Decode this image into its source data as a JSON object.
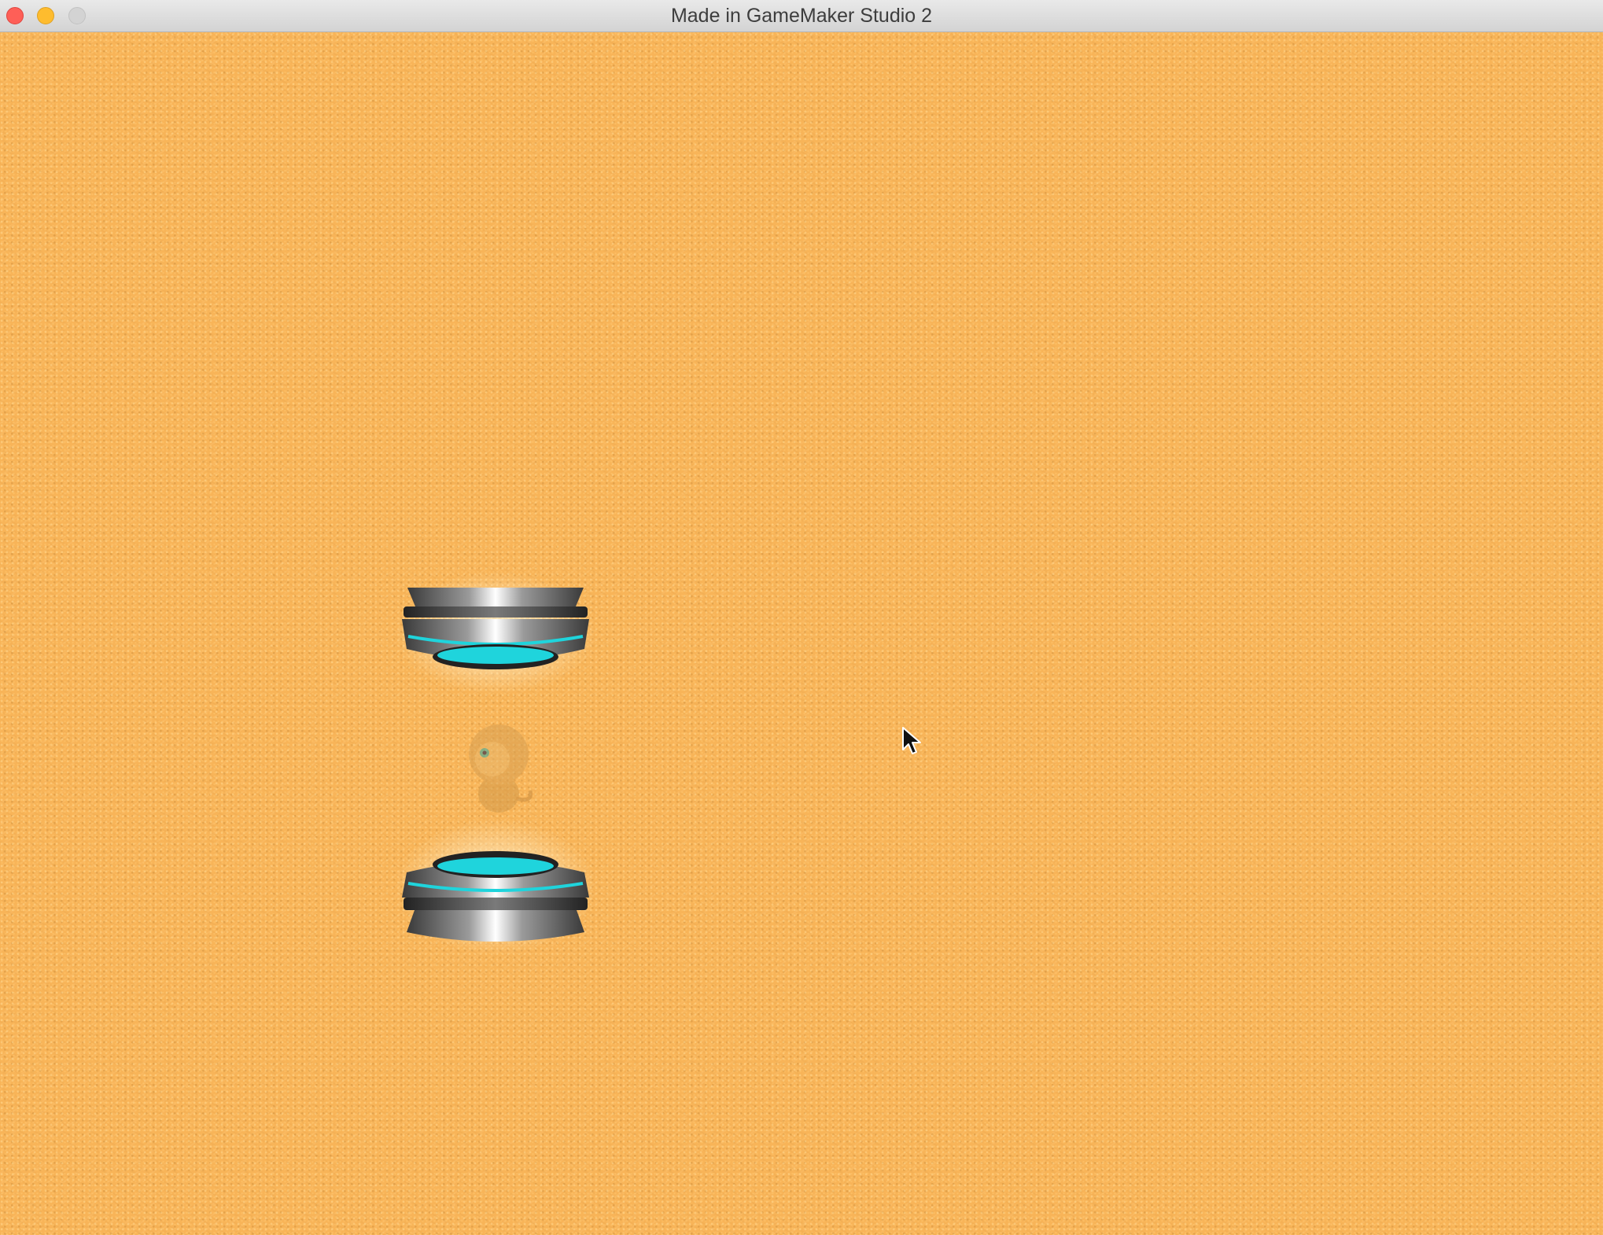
{
  "window": {
    "title": "Made in GameMaker Studio 2",
    "controls": [
      "close",
      "minimize",
      "zoom"
    ]
  },
  "scene": {
    "background": "sand",
    "background_color": "#f8b458",
    "portal_glow_color": "#1fd4dc",
    "sprites": [
      {
        "name": "teleporter-top",
        "icon": "teleporter-icon",
        "orientation": "upside-down"
      },
      {
        "name": "monkey",
        "icon": "monkey-icon",
        "state": "faded"
      },
      {
        "name": "teleporter-bottom",
        "icon": "teleporter-icon",
        "orientation": "upright"
      }
    ],
    "cursor": "arrow-cursor-icon"
  }
}
